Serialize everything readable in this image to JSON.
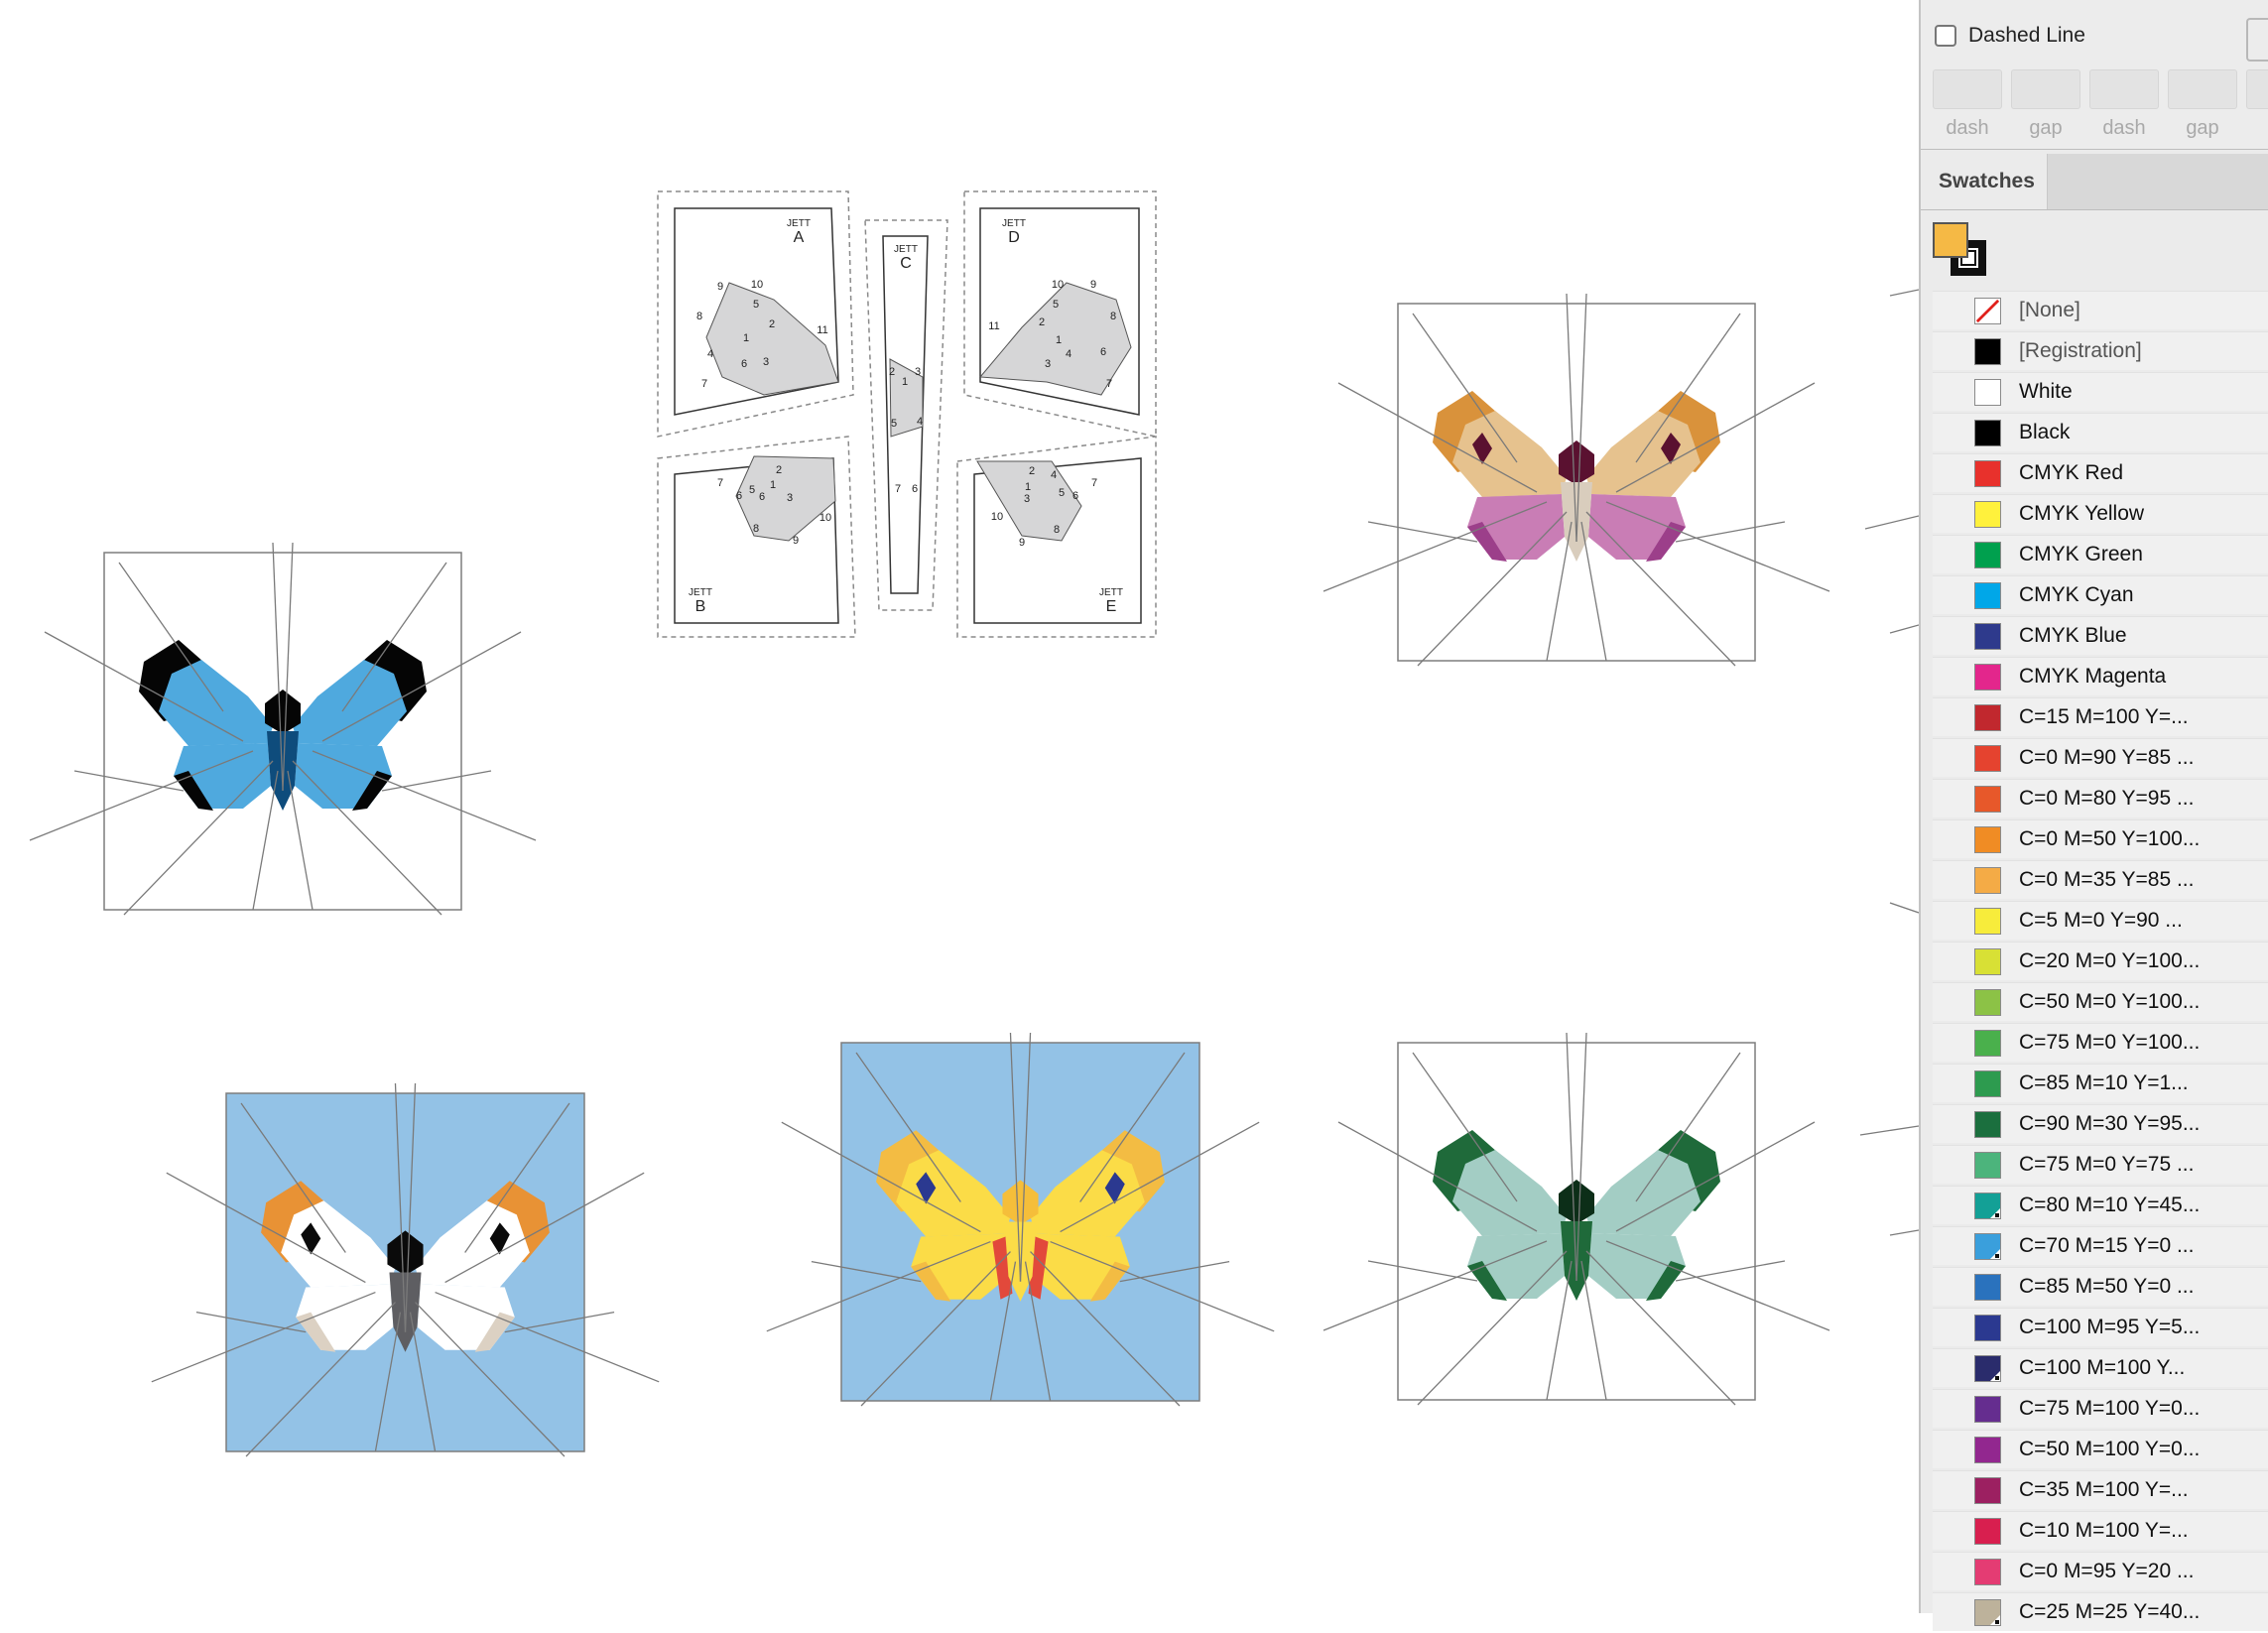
{
  "stroke_panel": {
    "dashed_label": "Dashed Line",
    "dashed_checked": false,
    "dash_fields": [
      "dash",
      "gap",
      "dash",
      "gap",
      "d"
    ]
  },
  "swatches_panel": {
    "tab_label": "Swatches",
    "fill_color": "#f5b945",
    "stroke_color": "#111111",
    "items": [
      {
        "name": "[None]",
        "color": "none",
        "grey": true
      },
      {
        "name": "[Registration]",
        "color": "#000000",
        "grey": true
      },
      {
        "name": "White",
        "color": "#ffffff"
      },
      {
        "name": "Black",
        "color": "#000000"
      },
      {
        "name": "CMYK Red",
        "color": "#e8312c"
      },
      {
        "name": "CMYK Yellow",
        "color": "#fff13c"
      },
      {
        "name": "CMYK Green",
        "color": "#00a04e"
      },
      {
        "name": "CMYK Cyan",
        "color": "#00a7e8"
      },
      {
        "name": "CMYK Blue",
        "color": "#2e3a8c"
      },
      {
        "name": "CMYK Magenta",
        "color": "#e3268c"
      },
      {
        "name": "C=15 M=100 Y=...",
        "color": "#c1282e"
      },
      {
        "name": "C=0 M=90 Y=85 ...",
        "color": "#e5432f"
      },
      {
        "name": "C=0 M=80 Y=95 ...",
        "color": "#e7582a"
      },
      {
        "name": "C=0 M=50 Y=100...",
        "color": "#f08c24"
      },
      {
        "name": "C=0 M=35 Y=85 ...",
        "color": "#f4ab46"
      },
      {
        "name": "C=5 M=0 Y=90 ...",
        "color": "#f7ec3b"
      },
      {
        "name": "C=20 M=0 Y=100...",
        "color": "#d8e035"
      },
      {
        "name": "C=50 M=0 Y=100...",
        "color": "#8cc246"
      },
      {
        "name": "C=75 M=0 Y=100...",
        "color": "#4ab04c"
      },
      {
        "name": "C=85 M=10 Y=1...",
        "color": "#2d9b4f"
      },
      {
        "name": "C=90 M=30 Y=95...",
        "color": "#1b6f3e"
      },
      {
        "name": "C=75 M=0 Y=75 ...",
        "color": "#4cb47c"
      },
      {
        "name": "C=80 M=10 Y=45...",
        "color": "#13a096",
        "spot": true
      },
      {
        "name": "C=70 M=15 Y=0 ...",
        "color": "#3a9fdc",
        "spot": true
      },
      {
        "name": "C=85 M=50 Y=0 ...",
        "color": "#2a72bd"
      },
      {
        "name": "C=100 M=95 Y=5...",
        "color": "#2b3990"
      },
      {
        "name": "C=100 M=100 Y...",
        "color": "#2a2c6c",
        "spot": true
      },
      {
        "name": "C=75 M=100 Y=0...",
        "color": "#652d8f"
      },
      {
        "name": "C=50 M=100 Y=0...",
        "color": "#92278f"
      },
      {
        "name": "C=35 M=100 Y=...",
        "color": "#9c2061"
      },
      {
        "name": "C=10 M=100 Y=...",
        "color": "#d81f4f"
      },
      {
        "name": "C=0 M=95 Y=20 ...",
        "color": "#e43c73"
      },
      {
        "name": "C=25 M=25 Y=40...",
        "color": "#bdb29b",
        "spot": true
      }
    ]
  },
  "pattern_pieces": [
    {
      "id": "A",
      "brand": "JETT",
      "nums": [
        "9",
        "10",
        "8",
        "5",
        "2",
        "1",
        "4",
        "6",
        "3",
        "7",
        "11"
      ]
    },
    {
      "id": "B",
      "brand": "JETT",
      "nums": [
        "2",
        "6",
        "5",
        "1",
        "7",
        "6",
        "3",
        "10",
        "8",
        "9"
      ]
    },
    {
      "id": "C",
      "brand": "JETT",
      "nums": [
        "2",
        "3",
        "1",
        "5",
        "4",
        "7",
        "6"
      ]
    },
    {
      "id": "D",
      "brand": "JETT",
      "nums": [
        "10",
        "9",
        "5",
        "11",
        "2",
        "8",
        "1",
        "4",
        "6",
        "3",
        "7"
      ]
    },
    {
      "id": "E",
      "brand": "JETT",
      "nums": [
        "2",
        "4",
        "7",
        "1",
        "5",
        "3",
        "6",
        "10",
        "8",
        "9"
      ]
    }
  ],
  "blocks": [
    {
      "id": "blue",
      "bg": "#ffffff",
      "upper": "#4fa9de",
      "lower": "#4fa9de",
      "outer": "#050505",
      "body": "#050505",
      "abdomen": "#0e4c7c",
      "spot": ""
    },
    {
      "id": "peach",
      "bg": "#ffffff",
      "upper": "#e6c28e",
      "lower": "#c97db5",
      "outer": "#d9923b",
      "body": "#5a1130",
      "abdomen": "#d9cdbd",
      "spot": "#5a1130",
      "lowerouter": "#9c3f8a"
    },
    {
      "id": "orange",
      "bg": "#93c2e6",
      "upper": "#ffffff",
      "lower": "#ffffff",
      "outer": "#e89235",
      "body": "#0a0a0a",
      "abdomen": "#5e5e62",
      "spot": "#0a0a0a",
      "lowerouter": "#dcd1c3"
    },
    {
      "id": "yellow",
      "bg": "#93c2e6",
      "upper": "#fbdc47",
      "lower": "#fbdc47",
      "outer": "#f3bc43",
      "body": "#f5be3a",
      "abdomen": "#fbdc47",
      "spot": "#2b3990",
      "stripe": "#e2493b"
    },
    {
      "id": "green",
      "bg": "#ffffff",
      "upper": "#a3cdc4",
      "lower": "#a3cdc4",
      "outer": "#1f6a3a",
      "body": "#0c2e18",
      "abdomen": "#1f6a3a",
      "spot": ""
    }
  ]
}
